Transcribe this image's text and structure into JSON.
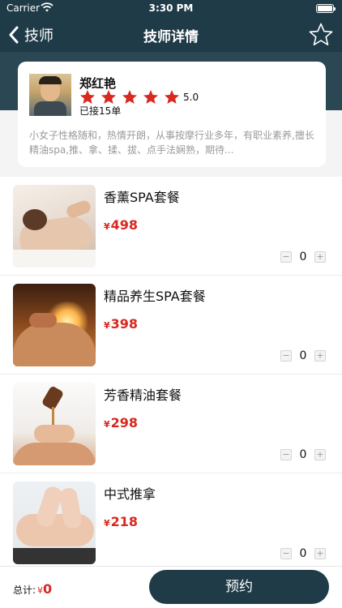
{
  "status_bar": {
    "carrier": "Carrier",
    "time": "3:30 PM"
  },
  "nav": {
    "back_label": "技师",
    "title": "技师详情",
    "favorite_icon": "star-outline-icon"
  },
  "technician": {
    "name": "郑红艳",
    "rating": 5,
    "rating_text": "5.0",
    "orders_text": "已接15单",
    "description": "小女子性格随和，热情开朗，从事按摩行业多年，有职业素养,擅长精油spa,推、拿、揉、拔、点手法娴熟，期待..."
  },
  "packages": [
    {
      "name": "香薰SPA套餐",
      "currency": "¥",
      "price": "498",
      "quantity": "0"
    },
    {
      "name": "精品养生SPA套餐",
      "currency": "¥",
      "price": "398",
      "quantity": "0"
    },
    {
      "name": "芳香精油套餐",
      "currency": "¥",
      "price": "298",
      "quantity": "0"
    },
    {
      "name": "中式推拿",
      "currency": "¥",
      "price": "218",
      "quantity": "0"
    }
  ],
  "stepper": {
    "minus": "−",
    "plus": "+"
  },
  "footer": {
    "total_label": "总计:",
    "currency": "¥",
    "total_amount": "0",
    "book_label": "预约"
  },
  "colors": {
    "primary": "#1f3b47",
    "price": "#d8281f",
    "star": "#d8281f"
  }
}
